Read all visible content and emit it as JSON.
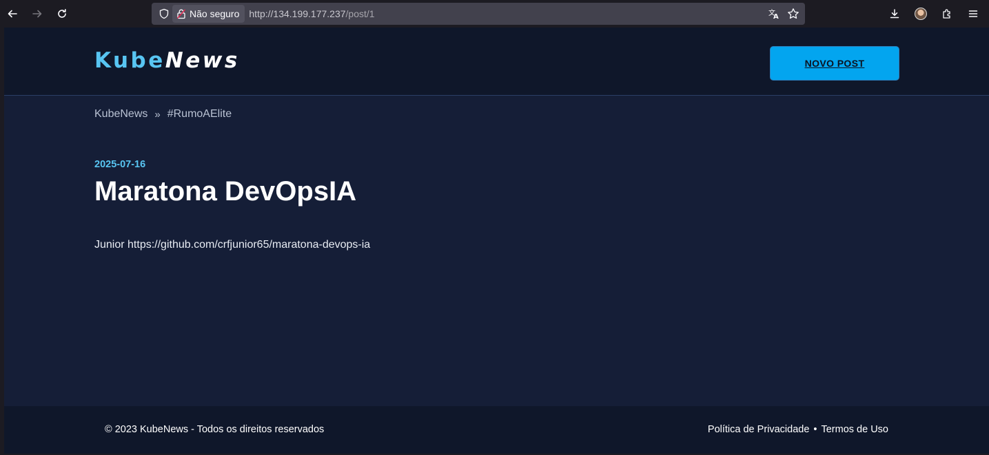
{
  "browser": {
    "security_label": "Não seguro",
    "url_host": "http://134.199.177.237",
    "url_path": "/post/1"
  },
  "header": {
    "logo_part1": "Kube",
    "logo_part2": "News",
    "new_post_label": "NOVO POST"
  },
  "breadcrumb": {
    "home": "KubeNews",
    "separator": "»",
    "current": "#RumoAElite"
  },
  "post": {
    "date": "2025-07-16",
    "title": "Maratona DevOpsIA",
    "body": "Junior https://github.com/crfjunior65/maratona-devops-ia"
  },
  "footer": {
    "copyright": "© 2023 KubeNews - Todos os direitos reservados",
    "privacy": "Política de Privacidade",
    "separator": "•",
    "terms": "Termos de Uso"
  },
  "colors": {
    "accent": "#03a5ef",
    "logo_blue": "#58c5f2",
    "header_bg": "#0f172a",
    "page_bg": "#151e37"
  },
  "icons": {
    "back": "arrow-left-icon",
    "forward": "arrow-right-icon",
    "reload": "reload-icon",
    "shield": "shield-icon",
    "insecure_lock": "lock-insecure-icon",
    "translate": "translate-icon",
    "bookmark": "star-icon",
    "downloads": "download-icon",
    "account": "avatar",
    "extensions": "puzzle-icon",
    "menu": "hamburger-menu-icon"
  }
}
